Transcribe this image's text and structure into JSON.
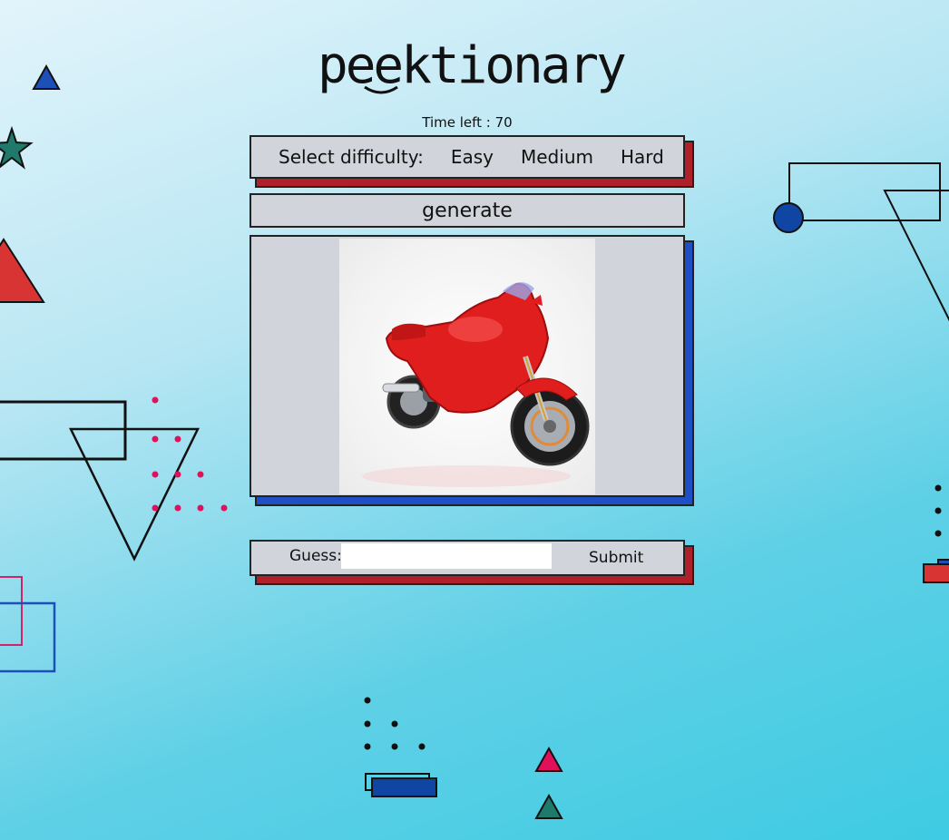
{
  "app": {
    "logo_text": "peektionary"
  },
  "timer": {
    "text": "Time left : 70"
  },
  "difficulty": {
    "label": "Select difficulty:",
    "options": [
      "Easy",
      "Medium",
      "Hard"
    ]
  },
  "generate": {
    "label": "generate"
  },
  "guess": {
    "label": "Guess:",
    "value": "",
    "submit_label": "Submit"
  },
  "colors": {
    "panel": "#d1d4da",
    "shadow_red": "#b0202b",
    "shadow_blue": "#1e4fc4",
    "accent_pink": "#e0105a",
    "accent_teal": "#1a7a6a",
    "accent_navy": "#0f46a4"
  }
}
